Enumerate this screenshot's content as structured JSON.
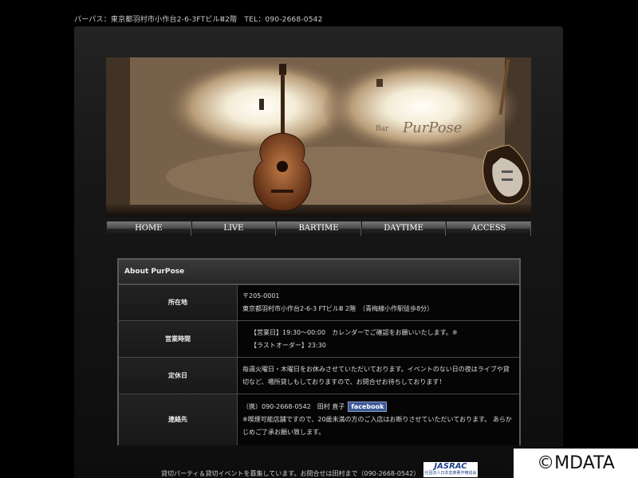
{
  "header": {
    "topline": "パーパス：東京都羽村市小作台2-6-3FTビルⅢ2階　TEL：090-2668-0542"
  },
  "hero": {
    "sign_small": "Bar",
    "sign_main": "PurPose"
  },
  "nav": {
    "items": [
      "HOME",
      "LIVE",
      "BARTIME",
      "DAYTIME",
      "ACCESS"
    ]
  },
  "about": {
    "title": "About PurPose",
    "rows": [
      {
        "label": "所在地",
        "lines": [
          "〒205-0001",
          "東京都羽村市小作台2-6-3 FTビルⅢ 2階　（青梅線小作駅徒歩8分）"
        ]
      },
      {
        "label": "営業時間",
        "lines": [
          "【営業日】19:30〜00:00　カレンダーでご確認をお願いいたします。※",
          "【ラストオーダー】23:30"
        ]
      },
      {
        "label": "定休日",
        "lines": [
          "毎週火曜日・木曜日をお休みさせていただいております。イベントのない日の夜はライブや貸",
          "切など、場所貸しもしておりますので、お問合せお待ちしております！"
        ]
      },
      {
        "label": "連絡先",
        "lines": [
          "（携）090-2668-0542　田村 直子",
          "※喫煙可能店舗ですので、20歳未満の方のご入店はお断りさせていただいております。 あらかじめご了承お願い致します。"
        ],
        "facebook": "facebook"
      }
    ]
  },
  "footer": {
    "text": "貸切パーティ＆貸切イベントを募集しています。お問合せは田村まで（090-2668-0542）"
  },
  "jasrac": {
    "logo": "JASRAC",
    "sub": "社団法人日本音楽著作権協会"
  },
  "watermark": "©MDATA",
  "colors": {
    "background": "#000000",
    "facebook": "#3b5998"
  }
}
